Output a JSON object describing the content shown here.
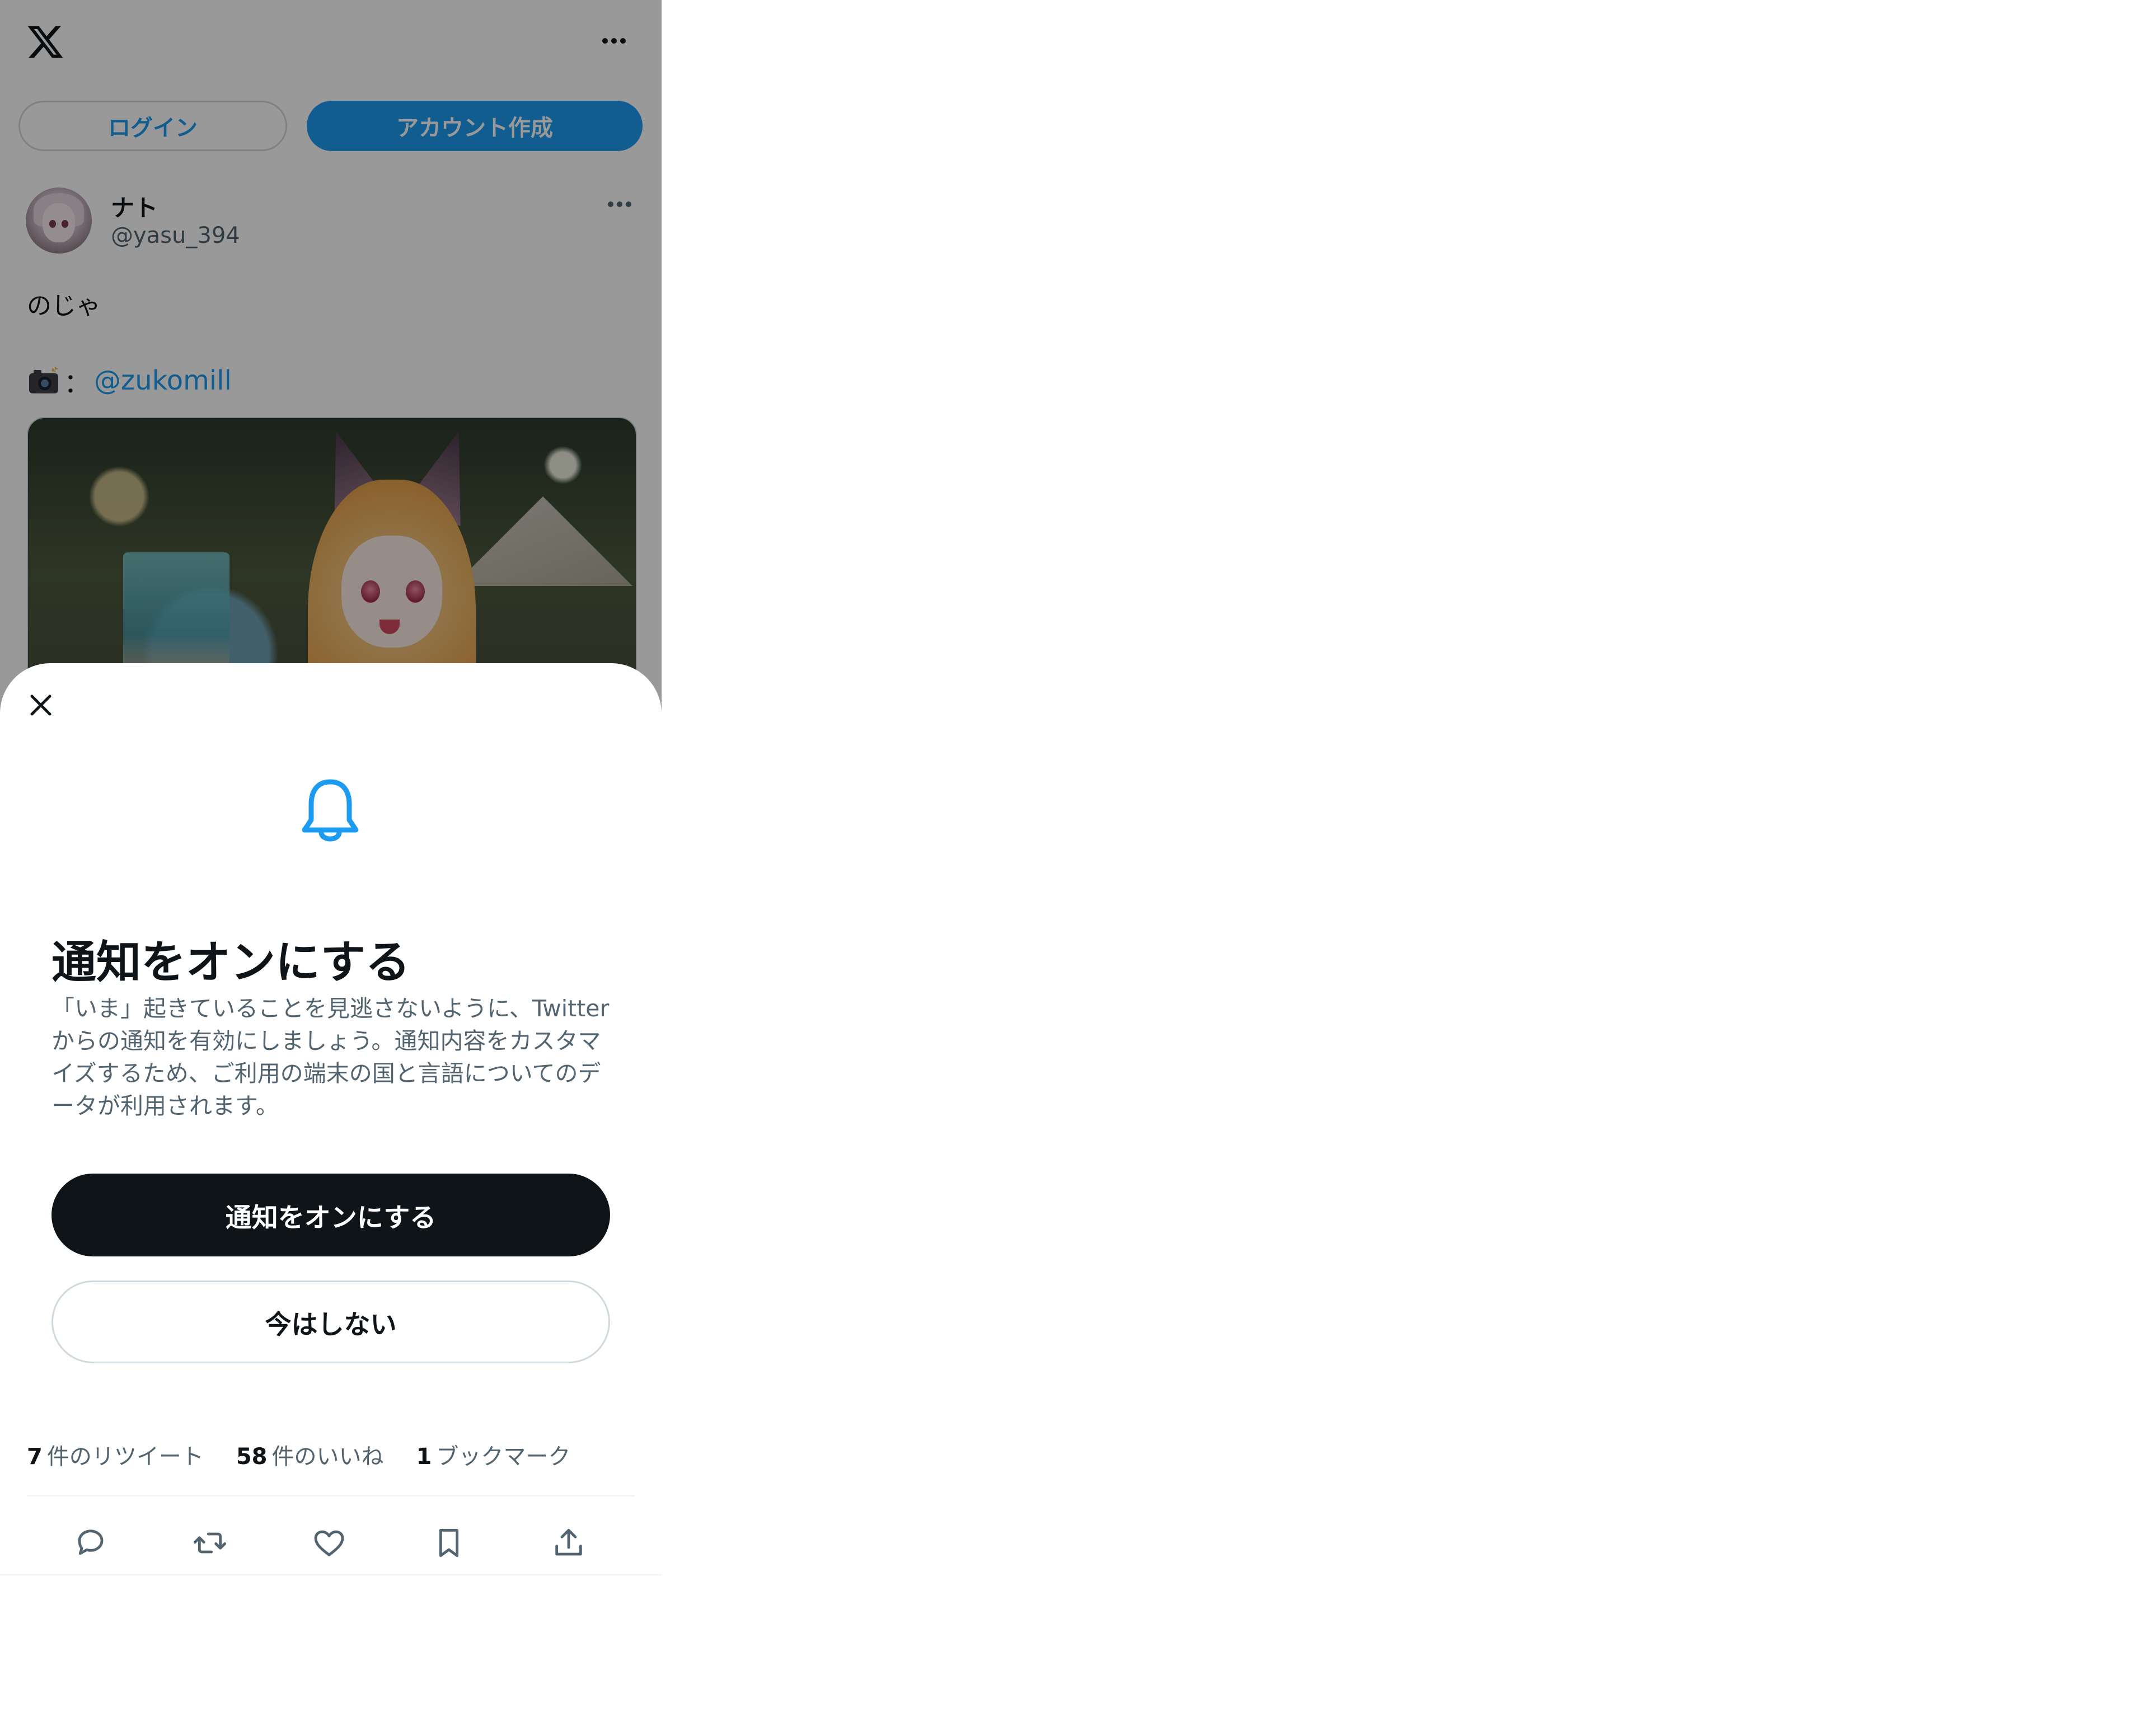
{
  "header": {
    "logo_icon": "x-logo-icon",
    "more_icon": "more-horizontal-icon"
  },
  "auth": {
    "login_label": "ログイン",
    "signup_label": "アカウント作成"
  },
  "tweet": {
    "display_name": "ナト",
    "handle": "@yasu_394",
    "text": "のじゃ",
    "camera_icon": "camera-icon",
    "camera_separator": "：",
    "mention": "@zukomill",
    "image_icon": "tweet-photo"
  },
  "sheet": {
    "close_icon": "close-icon",
    "bell_icon": "bell-icon",
    "title": "通知をオンにする",
    "description": "「いま」起きていることを見逃さないように、Twitterからの通知を有効にしましょう。通知内容をカスタマイズするため、ご利用の端末の国と言語についてのデータが利用されます。",
    "primary_button": "通知をオンにする",
    "secondary_button": "今はしない"
  },
  "stats": {
    "retweets": {
      "count": "7",
      "label": "件のリツイート"
    },
    "likes": {
      "count": "58",
      "label": "件のいいね"
    },
    "bookmarks": {
      "count": "1",
      "label": "ブックマーク"
    }
  },
  "actions": [
    "reply-icon",
    "retweet-icon",
    "like-icon",
    "bookmark-icon",
    "share-icon"
  ],
  "colors": {
    "accent": "#1d9bf0",
    "text_primary": "#0f1419",
    "text_secondary": "#536471",
    "border": "#cfd9de"
  }
}
